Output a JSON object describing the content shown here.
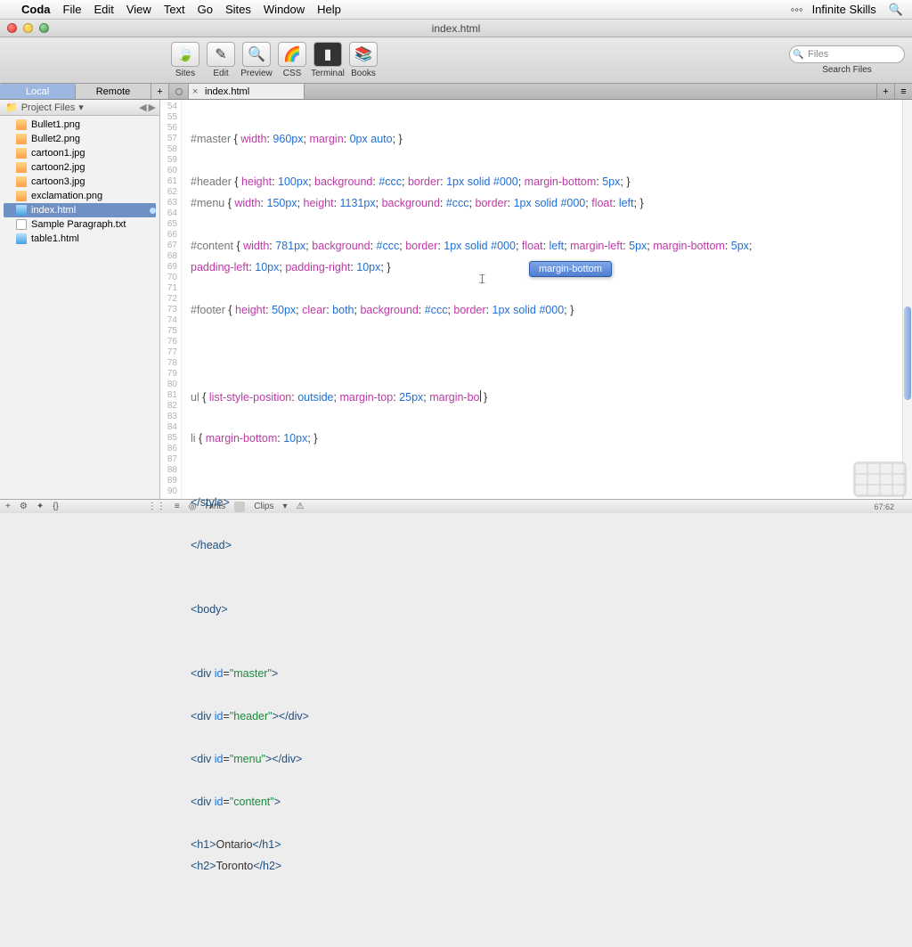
{
  "menubar": {
    "app": "Coda",
    "items": [
      "File",
      "Edit",
      "View",
      "Text",
      "Go",
      "Sites",
      "Window",
      "Help"
    ],
    "right": "Infinite Skills"
  },
  "window": {
    "title": "index.html"
  },
  "toolbar": {
    "buttons": [
      {
        "label": "Sites",
        "glyph": "🍃"
      },
      {
        "label": "Edit",
        "glyph": "✎"
      },
      {
        "label": "Preview",
        "glyph": "🔍"
      },
      {
        "label": "CSS",
        "glyph": "🌈"
      },
      {
        "label": "Terminal",
        "glyph": "▮"
      },
      {
        "label": "Books",
        "glyph": "📚"
      }
    ],
    "search_placeholder": "Files",
    "search_label": "Search Files"
  },
  "tabs": {
    "source1": "Local",
    "source2": "Remote",
    "file": "index.html"
  },
  "sidebar": {
    "header": "Project Files",
    "files": [
      {
        "name": "Bullet1.png",
        "type": "img"
      },
      {
        "name": "Bullet2.png",
        "type": "img"
      },
      {
        "name": "cartoon1.jpg",
        "type": "img"
      },
      {
        "name": "cartoon2.jpg",
        "type": "img"
      },
      {
        "name": "cartoon3.jpg",
        "type": "img"
      },
      {
        "name": "exclamation.png",
        "type": "img"
      },
      {
        "name": "index.html",
        "type": "htm",
        "selected": true
      },
      {
        "name": "Sample Paragraph.txt",
        "type": "txt"
      },
      {
        "name": "table1.html",
        "type": "htm"
      }
    ]
  },
  "editor": {
    "first_line": 54,
    "lines": {
      "55": {
        "sel": "#master",
        "body": "width: 960px; margin: 0px auto;"
      },
      "57": {
        "sel": "#header",
        "body": "height: 100px; background: #ccc; border: 1px solid #000; margin-bottom: 5px;"
      },
      "58": {
        "sel": "#menu",
        "body": "width: 150px; height: 1131px; background: #ccc; border: 1px solid #000; float: left;"
      },
      "60": {
        "sel": "#content",
        "body": "width: 781px; background: #ccc; border: 1px solid #000; float: left; margin-left: 5px; margin-bottom: 5px;"
      },
      "61": {
        "cont": "padding-left: 10px; padding-right: 10px;"
      },
      "63": {
        "sel": "#footer",
        "body": "height: 50px; clear: both; background: #ccc; border: 1px solid #000;"
      },
      "67": {
        "sel": "ul",
        "body": "list-style-position: outside; margin-top: 25px; margin-bo"
      },
      "69": {
        "sel": "li",
        "body": "margin-bottom: 10px;"
      },
      "72": "</style>",
      "74": "</head>",
      "77": "<body>",
      "80": "<div id=\"master\">",
      "82": "<div id=\"header\"></div>",
      "84": "<div id=\"menu\"></div>",
      "86": "<div id=\"content\">",
      "88_h1": "Ontario",
      "89_h2": "Toronto"
    },
    "autocomplete": "margin-bottom",
    "status_pos": "67:62"
  },
  "statusbar": {
    "hints": "Hints",
    "clips": "Clips"
  }
}
